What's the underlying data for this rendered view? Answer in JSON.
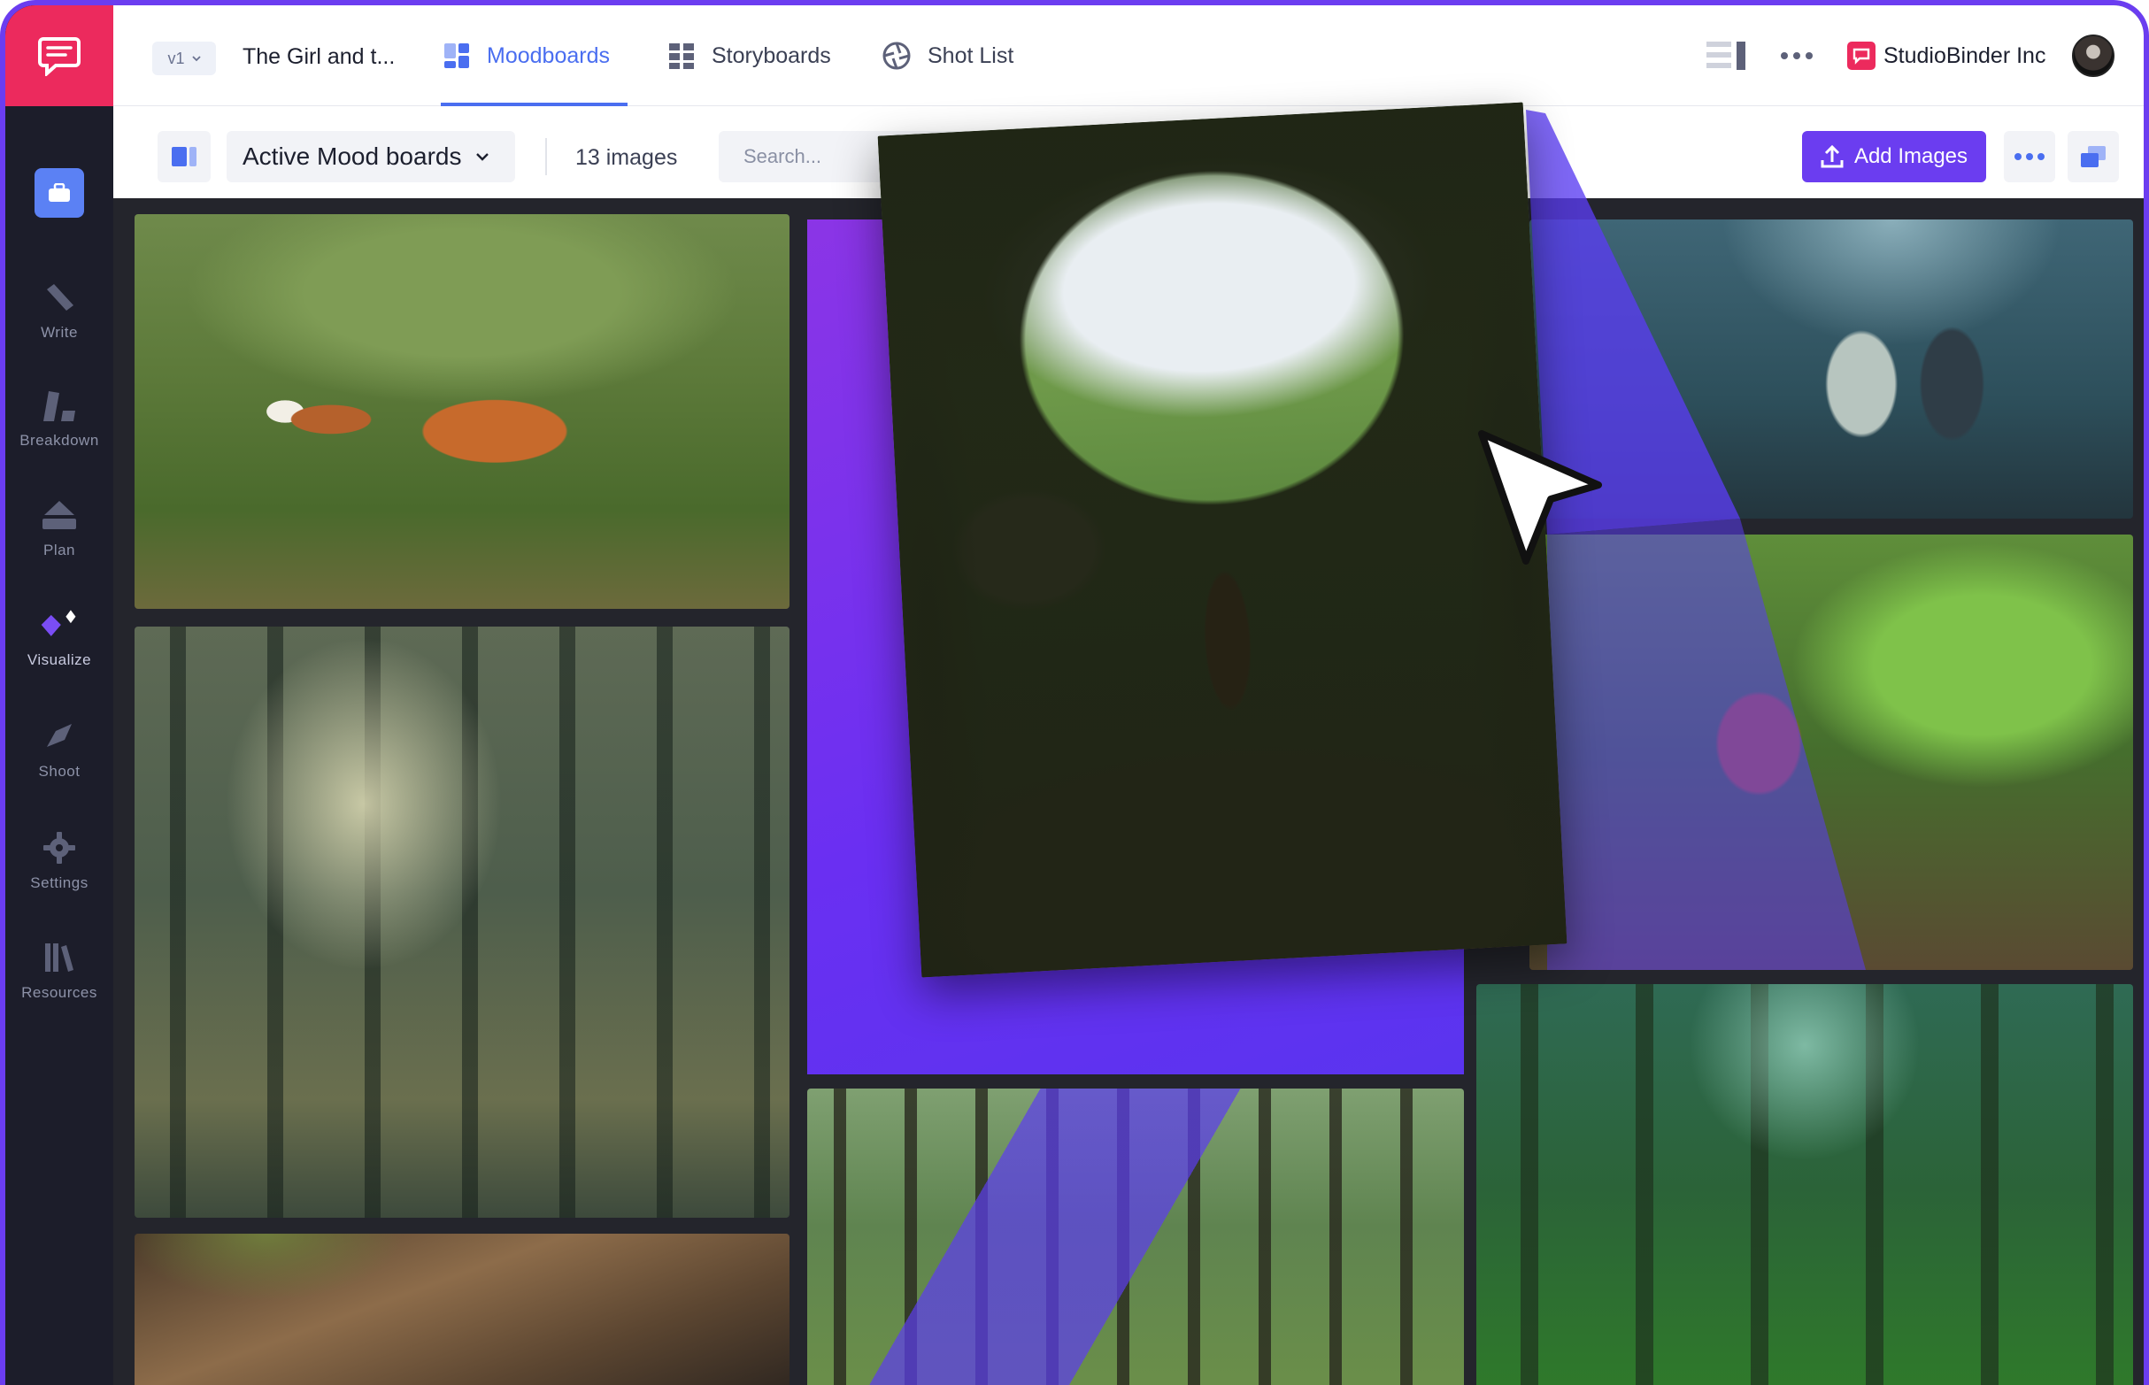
{
  "app": {
    "logo_icon": "chat-bubble-icon",
    "accent": "#6b3df0",
    "brand_pink": "#ec2a5d",
    "nav_blue": "#4a6ef0"
  },
  "sidebar": {
    "items": [
      {
        "label": "Write",
        "icon": "pencil-icon"
      },
      {
        "label": "Breakdown",
        "icon": "shapes-icon"
      },
      {
        "label": "Plan",
        "icon": "tent-icon"
      },
      {
        "label": "Visualize",
        "icon": "diamond-icon"
      },
      {
        "label": "Shoot",
        "icon": "megaphone-icon"
      },
      {
        "label": "Settings",
        "icon": "gear-icon"
      },
      {
        "label": "Resources",
        "icon": "books-icon"
      }
    ]
  },
  "header": {
    "version": "v1",
    "project_title": "The Girl and t...",
    "tabs": [
      {
        "label": "Moodboards",
        "icon": "moodboard-icon",
        "active": true
      },
      {
        "label": "Storyboards",
        "icon": "storyboard-grid-icon",
        "active": false
      },
      {
        "label": "Shot List",
        "icon": "camera-aperture-icon",
        "active": false
      }
    ],
    "org_name": "StudioBinder Inc"
  },
  "toolbar": {
    "board_select": "Active Mood boards",
    "image_count": "13 images",
    "search_placeholder": "Search...",
    "add_images_label": "Add Images"
  }
}
